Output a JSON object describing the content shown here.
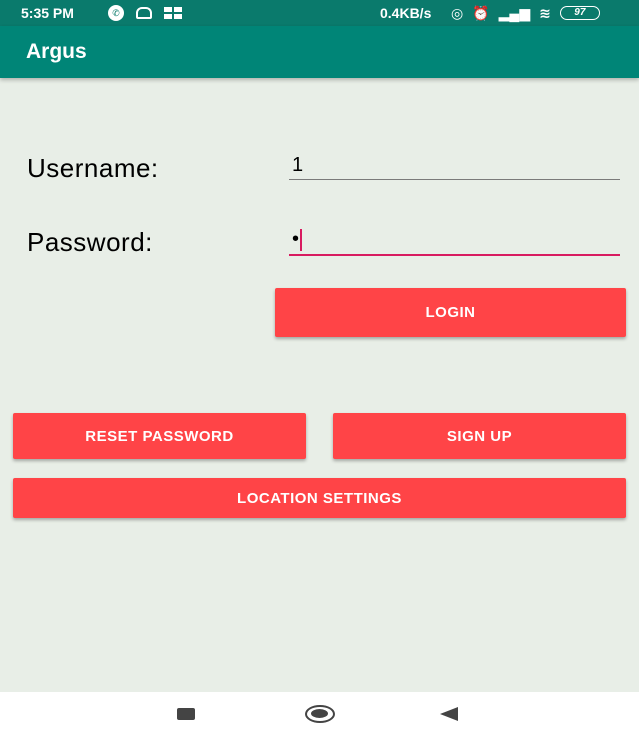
{
  "status_bar": {
    "time": "5:35 PM",
    "speed": "0.4KB/s",
    "battery": "97",
    "icons": [
      "whatsapp-icon",
      "android-icon",
      "grid-icon",
      "hotspot-icon",
      "alarm-icon",
      "signal-icon",
      "wifi-icon",
      "battery-icon"
    ]
  },
  "app_bar": {
    "title": "Argus"
  },
  "form": {
    "username_label": "Username:",
    "username_value": "1",
    "password_label": "Password:",
    "password_value": "•"
  },
  "buttons": {
    "login": "LOGIN",
    "reset_password": "RESET PASSWORD",
    "sign_up": "SIGN UP",
    "location_settings": "LOCATION SETTINGS"
  },
  "colors": {
    "app_bar": "#008577",
    "status_bar": "#0a7a6c",
    "button": "#ff4447",
    "accent": "#d81b60",
    "background": "#e8eee7"
  },
  "nav_bar": {
    "icons": [
      "recents-icon",
      "home-icon",
      "back-icon"
    ]
  }
}
